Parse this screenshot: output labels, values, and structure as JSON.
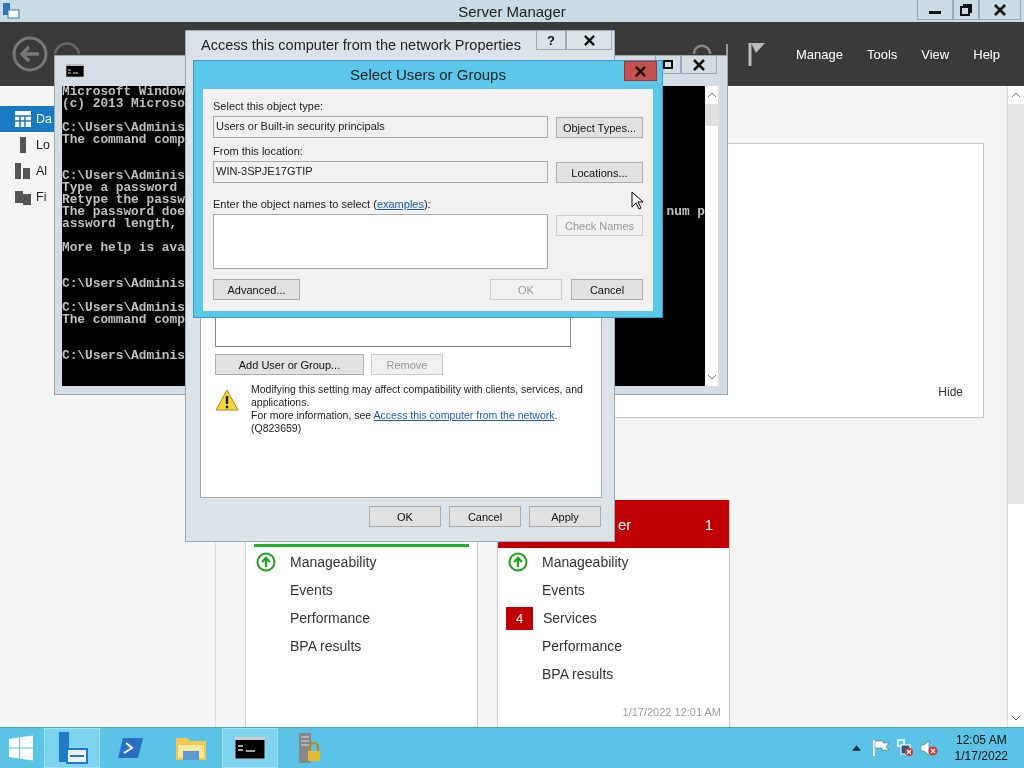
{
  "server_manager": {
    "title": "Server Manager",
    "menu": [
      "Manage",
      "Tools",
      "View",
      "Help"
    ],
    "sidebar": [
      {
        "label": "Da",
        "selected": true
      },
      {
        "label": "Lo",
        "selected": false
      },
      {
        "label": "Al",
        "selected": false
      },
      {
        "label": "Fi",
        "selected": false
      }
    ],
    "panel": {
      "hide_link": "Hide"
    },
    "tiles": [
      {
        "alert": false,
        "items": [
          {
            "label": "Manageability",
            "kind": "ok"
          },
          {
            "label": "Events",
            "kind": "plain"
          },
          {
            "label": "Performance",
            "kind": "plain"
          },
          {
            "label": "BPA results",
            "kind": "plain"
          }
        ]
      },
      {
        "alert": true,
        "title": "er",
        "count": "1",
        "timestamp": "1/17/2022 12:01 AM",
        "items": [
          {
            "label": "Manageability",
            "kind": "ok"
          },
          {
            "label": "Events",
            "kind": "plain"
          },
          {
            "label": "Services",
            "kind": "badge",
            "badge": "4"
          },
          {
            "label": "Performance",
            "kind": "plain"
          },
          {
            "label": "BPA results",
            "kind": "plain"
          }
        ]
      }
    ]
  },
  "cmd_window": {
    "text": "Microsoft Window\n(c) 2013 Microso\n\nC:\\Users\\Adminis\nThe command comp\n\n\nC:\\Users\\Adminis\nType a password \nRetype the passw\nThe password doe\nassword length,\n\nMore help is ava\n\n\nC:\\Users\\Adminis\n\nC:\\Users\\Adminis\nThe command comp\n\n\nC:\\Users\\Adminis",
    "tail": "num p"
  },
  "properties_dialog": {
    "title": "Access this computer from the network Properties",
    "help": "?",
    "add_button": {
      "label": "Add User or Group...",
      "disabled": false
    },
    "remove_button": {
      "label": "Remove",
      "disabled": true
    },
    "warning": "Modifying this setting may affect compatibility with clients, services, and applications.",
    "more_info": "For more information, see",
    "link": "Access this computer from the network",
    "link_end": ".",
    "kb": "(Q823659)",
    "buttons": [
      "OK",
      "Cancel",
      "Apply"
    ]
  },
  "select_dialog": {
    "title": "Select Users or Groups",
    "object_type_label": "Select this object type:",
    "object_type": "Users or Built-in security principals",
    "object_types_button": "Object Types...",
    "location_label": "From this location:",
    "location": "WIN-3SPJE17GTIP",
    "locations_button": "Locations...",
    "names_label": "Enter the object names to select (",
    "names_link": "examples",
    "names_label_end": "):",
    "check_names": {
      "label": "Check Names",
      "disabled": true
    },
    "advanced": {
      "label": "Advanced...",
      "disabled": false
    },
    "ok": {
      "label": "OK",
      "disabled": true
    },
    "cancel": {
      "label": "Cancel",
      "disabled": false
    }
  },
  "taskbar": {
    "apps": [
      {
        "kind": "server-manager"
      },
      {
        "kind": "powershell"
      },
      {
        "kind": "explorer"
      },
      {
        "kind": "cmd"
      },
      {
        "kind": "security"
      }
    ],
    "clock": {
      "time": "12:05 AM",
      "date": "1/17/2022"
    }
  }
}
